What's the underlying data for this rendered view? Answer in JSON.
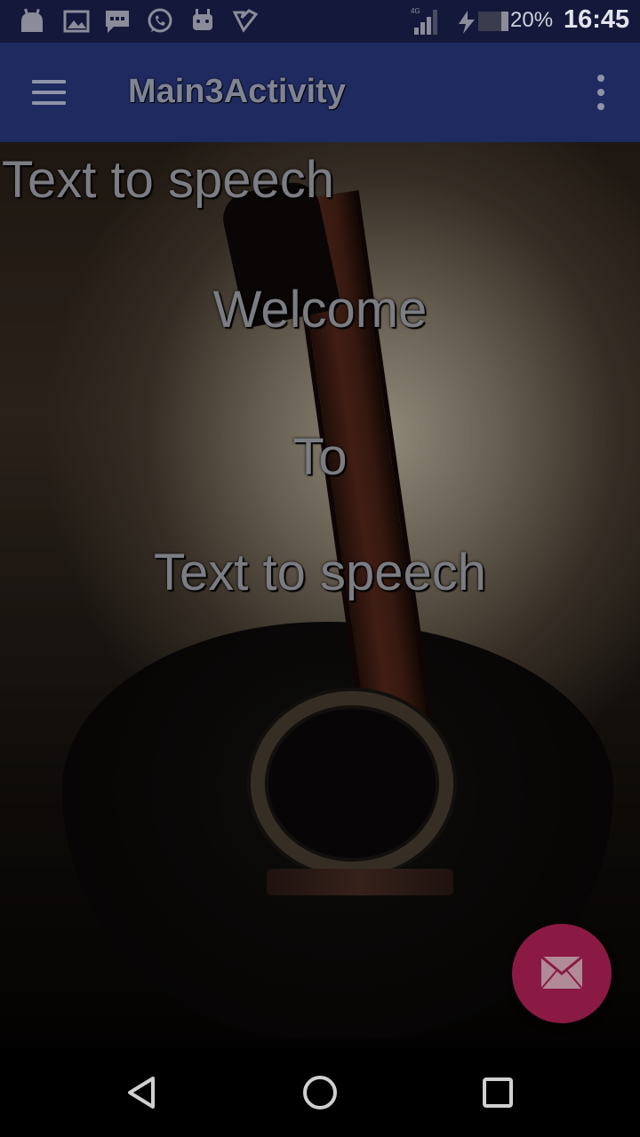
{
  "status_bar": {
    "network_type": "4G",
    "battery_percent": "20%",
    "time": "16:45",
    "icons": [
      "android-notification-icon",
      "image-icon",
      "chat-icon",
      "whatsapp-icon",
      "android-robot-icon",
      "checkmark-icon",
      "signal-icon",
      "charging-icon",
      "battery-icon"
    ]
  },
  "toolbar": {
    "title": "Main3Activity",
    "menu_icon": "hamburger-menu-icon",
    "overflow_icon": "more-vert-icon"
  },
  "content": {
    "label": "Text to speech",
    "welcome": "Welcome",
    "to": "To",
    "app_name": "Text to speech",
    "background_image": "acoustic-guitar-photo"
  },
  "fab": {
    "icon": "mail-icon",
    "color": "#8a1a44"
  },
  "navigation": {
    "back_icon": "back-triangle-icon",
    "home_icon": "home-circle-icon",
    "recents_icon": "recents-square-icon"
  },
  "colors": {
    "toolbar": "#1e2a60",
    "status_bar": "#14183a",
    "text": "#7c7d82"
  }
}
